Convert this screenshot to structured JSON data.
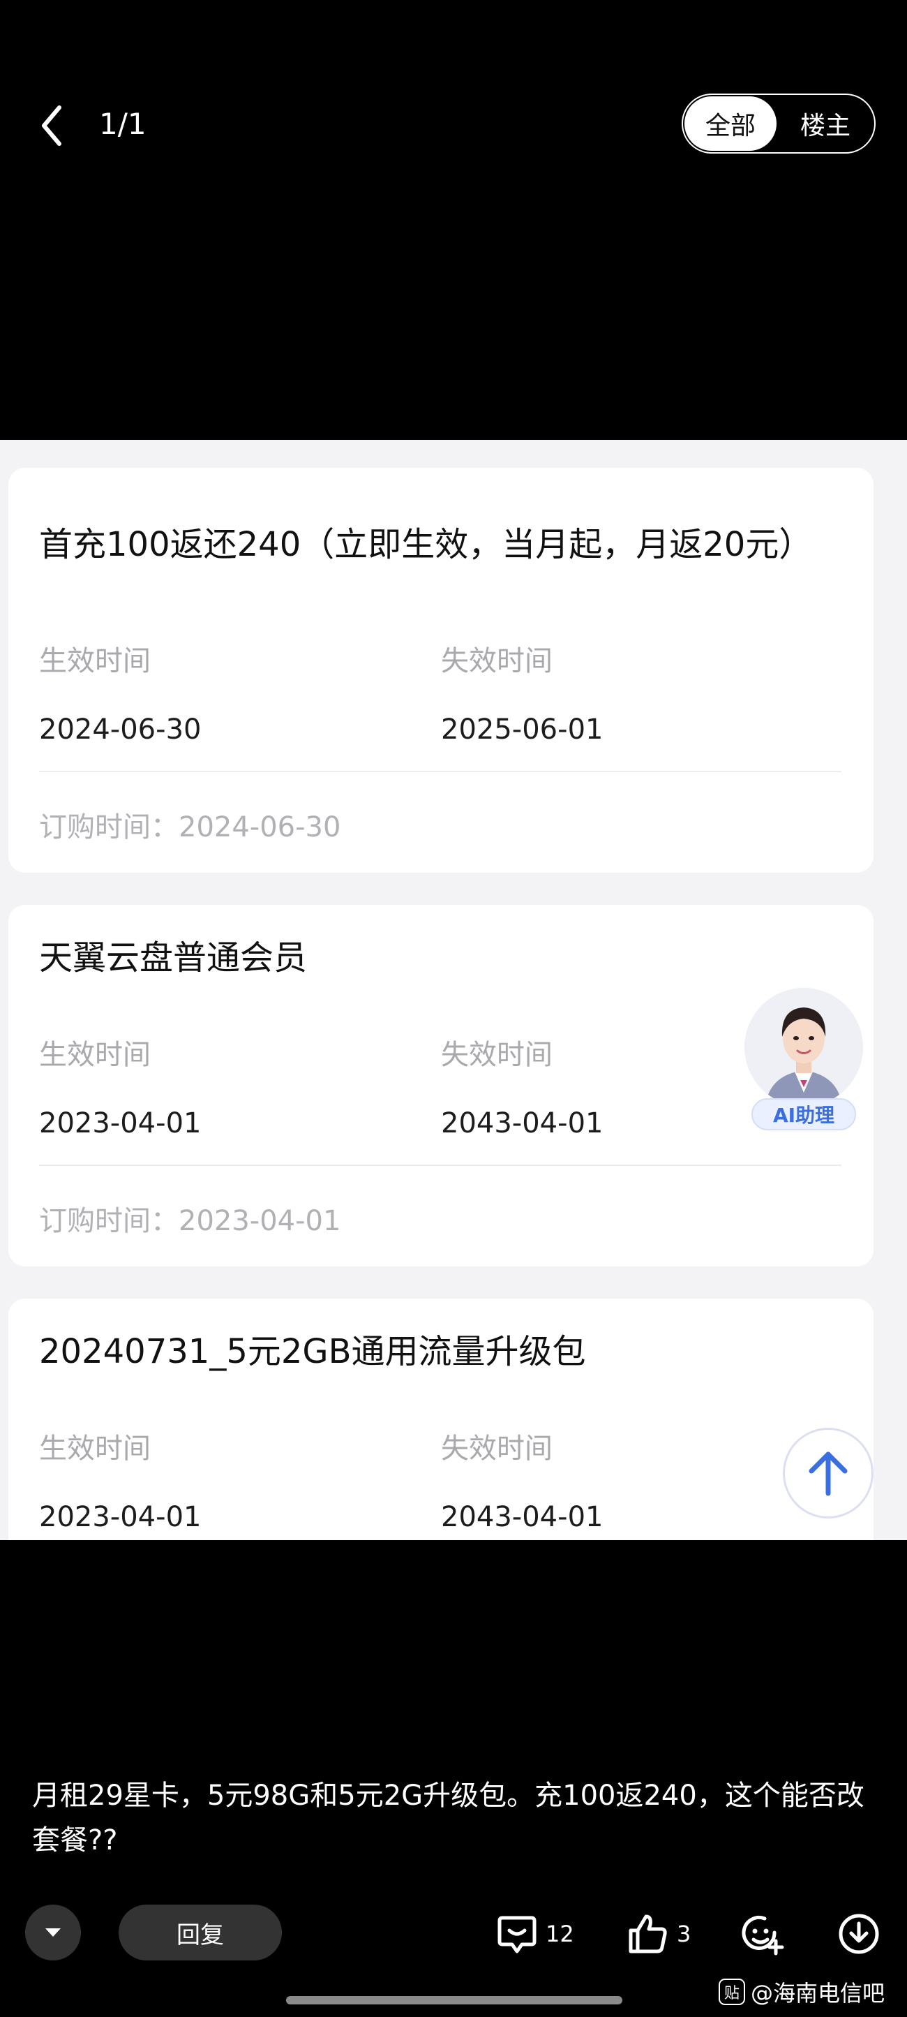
{
  "header": {
    "page_counter": "1/1",
    "filter_all": "全部",
    "filter_owner": "楼主"
  },
  "cards": [
    {
      "title": "首充100返还240（立即生效，当月起，月返20元）",
      "start_label": "生效时间",
      "start_value": "2024-06-30",
      "end_label": "失效时间",
      "end_value": "2025-06-01",
      "order_text": "订购时间：2024-06-30"
    },
    {
      "title": "天翼云盘普通会员",
      "start_label": "生效时间",
      "start_value": "2023-04-01",
      "end_label": "失效时间",
      "end_value": "2043-04-01",
      "order_text": "订购时间：2023-04-01"
    },
    {
      "title": "20240731_5元2GB通用流量升级包",
      "start_label": "生效时间",
      "start_value": "2023-04-01",
      "end_label": "失效时间",
      "end_value": "2043-04-01"
    }
  ],
  "ai_assistant": {
    "badge": "AI助理"
  },
  "caption": "月租29星卡，5元98G和5元2G升级包。充100返240，这个能否改套餐??",
  "toolbar": {
    "reply_label": "回复",
    "comment_count": "12",
    "like_count": "3"
  },
  "watermark": {
    "logo": "贴",
    "text": "@海南电信吧"
  },
  "colors": {
    "accent_blue": "#3a6fe0",
    "background": "#000000",
    "panel": "#f3f3f5"
  }
}
